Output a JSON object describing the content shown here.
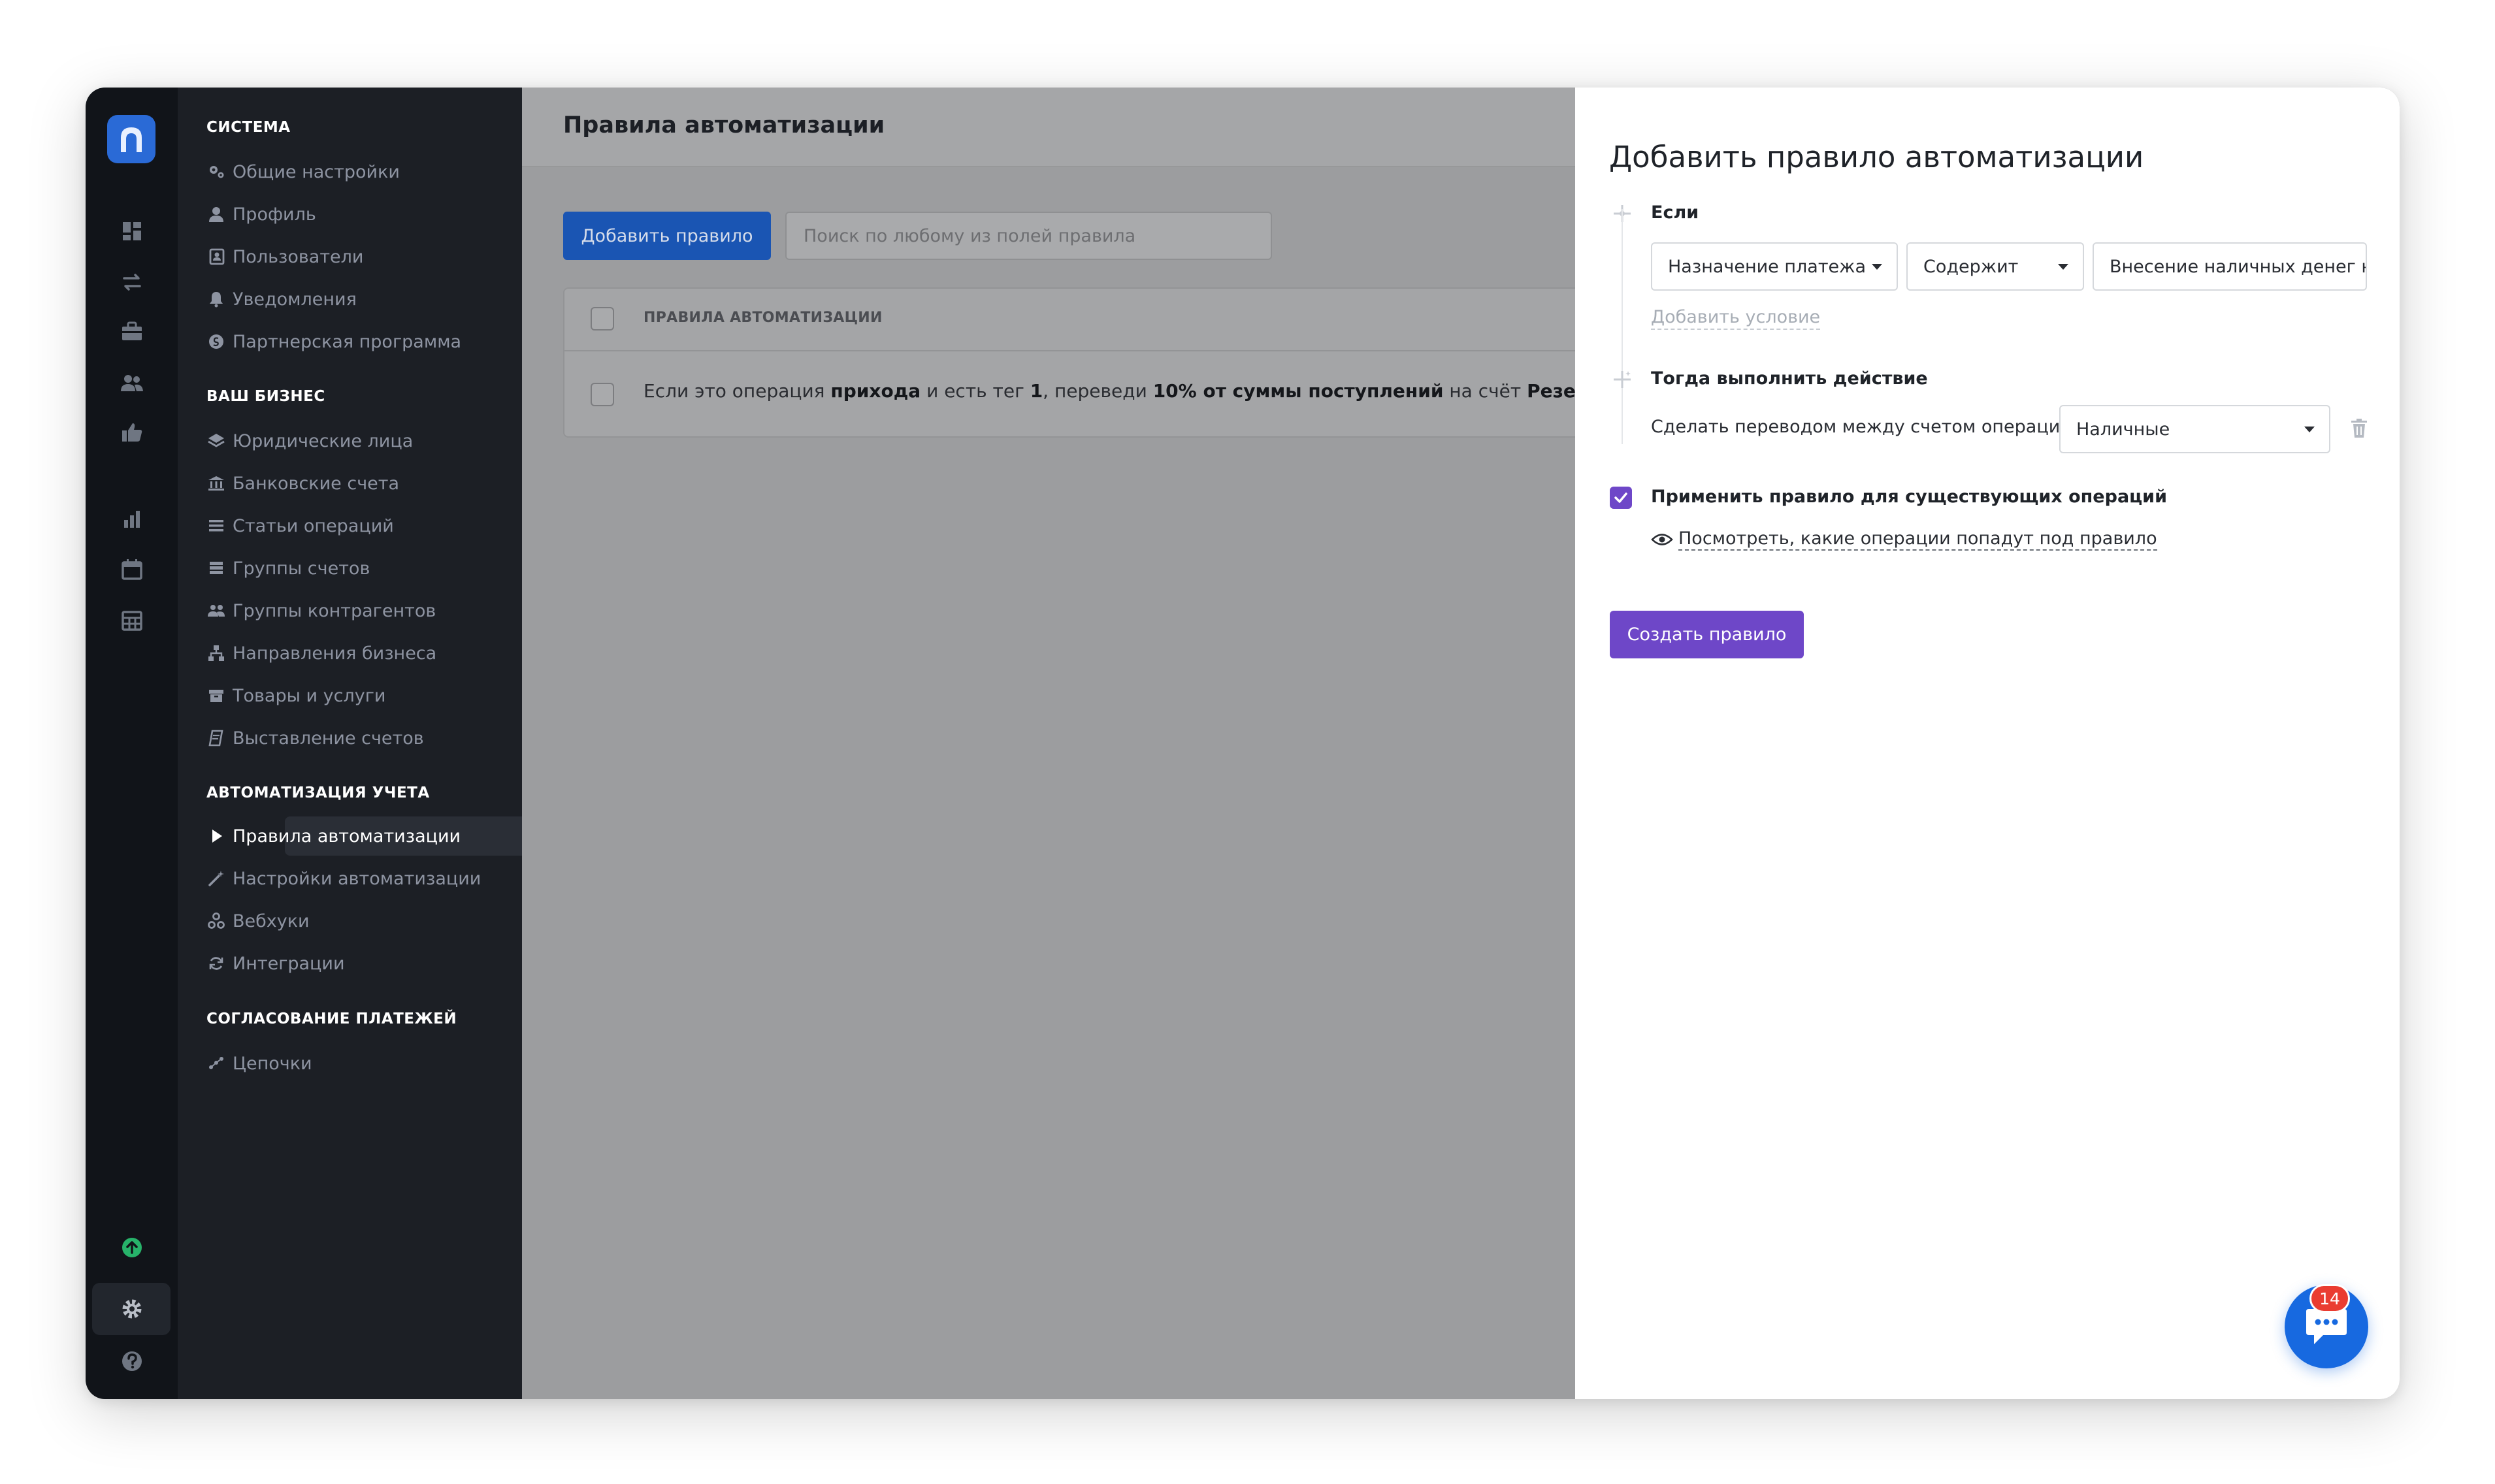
{
  "sidebar": {
    "sections": [
      {
        "title": "СИСТЕМА",
        "items": [
          {
            "label": "Общие настройки",
            "icon": "gears-icon"
          },
          {
            "label": "Профиль",
            "icon": "user-icon"
          },
          {
            "label": "Пользователи",
            "icon": "users-book-icon"
          },
          {
            "label": "Уведомления",
            "icon": "bell-icon"
          },
          {
            "label": "Партнерская программа",
            "icon": "coin-icon"
          }
        ]
      },
      {
        "title": "ВАШ БИЗНЕС",
        "items": [
          {
            "label": "Юридические лица",
            "icon": "layers-icon"
          },
          {
            "label": "Банковские счета",
            "icon": "bank-icon"
          },
          {
            "label": "Статьи операций",
            "icon": "list-icon"
          },
          {
            "label": "Группы счетов",
            "icon": "stack-icon"
          },
          {
            "label": "Группы контрагентов",
            "icon": "group-icon"
          },
          {
            "label": "Направления бизнеса",
            "icon": "sitemap-icon"
          },
          {
            "label": "Товары и услуги",
            "icon": "box-icon"
          },
          {
            "label": "Выставление счетов",
            "icon": "invoice-icon"
          }
        ]
      },
      {
        "title": "АВТОМАТИЗАЦИЯ УЧЕТА",
        "items": [
          {
            "label": "Правила автоматизации",
            "icon": "play-icon",
            "active": true
          },
          {
            "label": "Настройки автоматизации",
            "icon": "magic-wand-icon"
          },
          {
            "label": "Вебхуки",
            "icon": "webhook-icon"
          },
          {
            "label": "Интеграции",
            "icon": "sync-icon"
          }
        ]
      },
      {
        "title": "СОГЛАСОВАНИЕ ПЛАТЕЖЕЙ",
        "items": [
          {
            "label": "Цепочки",
            "icon": "chain-icon"
          }
        ]
      }
    ]
  },
  "main": {
    "title": "Правила автоматизации",
    "add_button": "Добавить правило",
    "search_placeholder": "Поиск по любому из полей правила",
    "table": {
      "header": "ПРАВИЛА АВТОМАТИЗАЦИИ",
      "row": {
        "p1": "Если это операция ",
        "b1": "прихода",
        "p2": " и есть тег ",
        "b2": "1",
        "p3": ", переведи ",
        "b3": "10% от суммы поступлений",
        "p4": " на счёт ",
        "b4": "Резервный фонд"
      }
    }
  },
  "panel": {
    "title": "Добавить правило автоматизации",
    "if_label": "Если",
    "condition": {
      "field": "Назначение платежа",
      "operator": "Содержит",
      "value": "Внесение наличных денег на"
    },
    "add_condition": "Добавить условие",
    "then_label": "Тогда выполнить действие",
    "action_text": "Сделать переводом между счетом операции и",
    "action_select": "Наличные",
    "apply_existing": "Применить правило для существующих операций",
    "preview_link": "Посмотреть, какие операции попадут под правило",
    "create_button": "Создать правило"
  },
  "chat": {
    "badge": "14"
  },
  "colors": {
    "accent_purple": "#6e47c8",
    "brand_blue": "#2a6ad6",
    "sidebar_bg": "#1c1f25",
    "rail_bg": "#111419",
    "badge_red": "#ea3c31"
  }
}
